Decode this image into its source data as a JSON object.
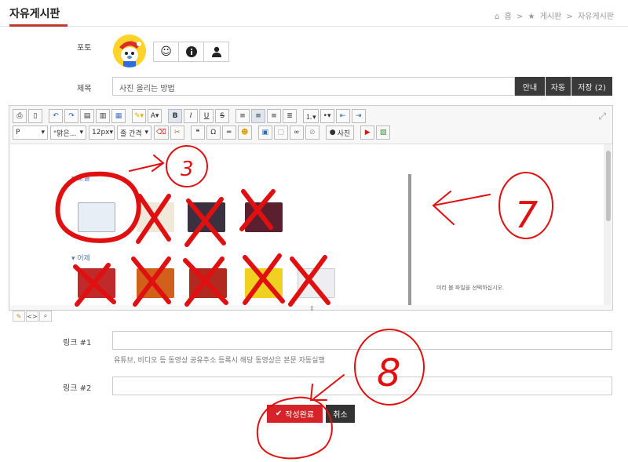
{
  "page": {
    "title": "자유게시판",
    "breadcrumb": [
      "홈",
      ">",
      "게시판",
      ">",
      "자유게시판"
    ]
  },
  "form": {
    "photo_label": "포토",
    "subject_label": "제목",
    "subject_value": "사진 올리는 방법",
    "tabs": [
      "안내",
      "자동",
      "저장 (2)"
    ],
    "link1_label": "링크 #1",
    "link2_label": "링크 #2",
    "link_help": "유튜브, 비디오 등 동영상 공유주소 등록시 해당 동영상은 본문 자동실행",
    "submit_label": "작성완료",
    "cancel_label": "취소"
  },
  "editor": {
    "format_select": "P",
    "font_select": "\"맑은...",
    "size_select": "12px",
    "line_height_select": "줄 간격",
    "photo_button": "사진",
    "group_today": "오늘",
    "group_yesterday": "어제",
    "preview_hint": "미리 볼 파일을 선택하십시오."
  },
  "annotations": [
    "3",
    "7",
    "8"
  ],
  "colors": {
    "accent": "#c0392b",
    "submit": "#d6232a",
    "dark": "#333333",
    "annotation": "#e01010"
  }
}
